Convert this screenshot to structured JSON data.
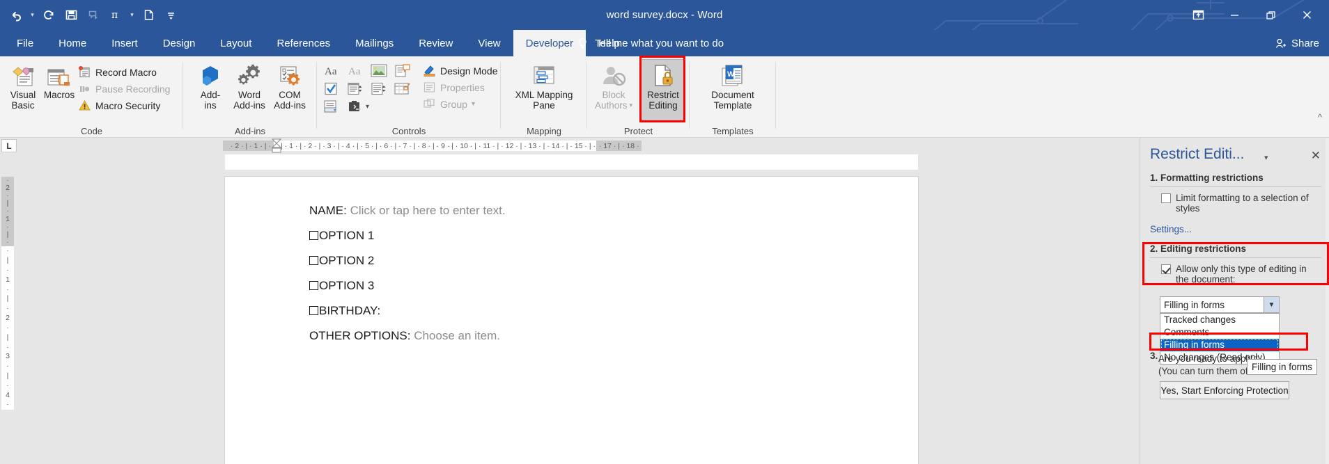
{
  "titlebar": {
    "document_title": "word survey.docx  -  Word",
    "quick_access": [
      {
        "name": "undo-icon",
        "label": "Undo",
        "caret": true
      },
      {
        "name": "redo-icon",
        "label": "Redo",
        "caret": false
      },
      {
        "name": "save-icon",
        "label": "Save",
        "caret": false
      },
      {
        "name": "touch-mode-icon",
        "label": "Touch/Mouse Mode",
        "caret": false,
        "dim": true
      },
      {
        "name": "equation-icon",
        "label": "Equation",
        "caret": true
      },
      {
        "name": "new-document-icon",
        "label": "New",
        "caret": false
      },
      {
        "name": "customize-qat-icon",
        "label": "Customize Quick Access Toolbar",
        "caret": false
      }
    ],
    "window_controls": [
      {
        "name": "ribbon-display-options-button",
        "label": "Ribbon Display Options"
      },
      {
        "name": "minimize-button",
        "label": "Minimize"
      },
      {
        "name": "restore-button",
        "label": "Restore Down"
      },
      {
        "name": "close-button",
        "label": "Close"
      }
    ]
  },
  "tabs": [
    {
      "label": "File",
      "active": false
    },
    {
      "label": "Home",
      "active": false
    },
    {
      "label": "Insert",
      "active": false
    },
    {
      "label": "Design",
      "active": false
    },
    {
      "label": "Layout",
      "active": false
    },
    {
      "label": "References",
      "active": false
    },
    {
      "label": "Mailings",
      "active": false
    },
    {
      "label": "Review",
      "active": false
    },
    {
      "label": "View",
      "active": false
    },
    {
      "label": "Developer",
      "active": true
    },
    {
      "label": "Help",
      "active": false
    }
  ],
  "tell_me": "Tell me what you want to do",
  "share": "Share",
  "ribbon": {
    "groups": [
      {
        "label": "Code"
      },
      {
        "label": "Add-ins"
      },
      {
        "label": "Controls"
      },
      {
        "label": "Mapping"
      },
      {
        "label": "Protect"
      },
      {
        "label": "Templates"
      }
    ],
    "code": {
      "visual_basic": "Visual\nBasic",
      "visual_basic_line1": "Visual",
      "visual_basic_line2": "Basic",
      "macros": "Macros",
      "record_macro": "Record Macro",
      "pause_recording": "Pause Recording",
      "macro_security": "Macro Security"
    },
    "addins": {
      "add_ins_line1": "Add-",
      "add_ins_line2": "ins",
      "word_add_ins_line1": "Word",
      "word_add_ins_line2": "Add-ins",
      "com_add_ins_line1": "COM",
      "com_add_ins_line2": "Add-ins"
    },
    "controls": {
      "design_mode": "Design Mode",
      "properties": "Properties",
      "group": "Group",
      "icons": [
        "rich-text-content-control-icon",
        "plain-text-content-control-icon",
        "picture-content-control-icon",
        "building-block-gallery-icon",
        "checkbox-content-control-icon",
        "combo-box-content-control-icon",
        "drop-down-list-content-control-icon",
        "date-picker-content-control-icon",
        "repeating-section-content-control-icon",
        "legacy-tools-icon"
      ]
    },
    "mapping": {
      "xml_mapping_pane_line1": "XML Mapping",
      "xml_mapping_pane_line2": "Pane"
    },
    "protect": {
      "block_authors_line1": "Block",
      "block_authors_line2": "Authors",
      "restrict_editing_line1": "Restrict",
      "restrict_editing_line2": "Editing"
    },
    "templates": {
      "document_template_line1": "Document",
      "document_template_line2": "Template"
    }
  },
  "ruler": {
    "horizontal_left": [
      "2",
      "1"
    ],
    "horizontal_right": [
      "1",
      "2",
      "3",
      "4",
      "5",
      "6",
      "7",
      "8",
      "9",
      "10",
      "11",
      "12",
      "13",
      "14",
      "15",
      "16",
      "17",
      "18"
    ],
    "vertical_top": [
      "2",
      "1"
    ],
    "vertical_bottom": [
      "1",
      "2",
      "3",
      "4"
    ],
    "corner_label": "L"
  },
  "document": {
    "lines": [
      {
        "label": "NAME:",
        "placeholder": "Click or tap here to enter text.",
        "checkbox": false
      },
      {
        "label": "OPTION 1",
        "placeholder": "",
        "checkbox": true
      },
      {
        "label": "OPTION 2",
        "placeholder": "",
        "checkbox": true
      },
      {
        "label": "OPTION 3",
        "placeholder": "",
        "checkbox": true
      },
      {
        "label": "BIRTHDAY:",
        "placeholder": "",
        "checkbox": true
      },
      {
        "label": "OTHER OPTIONS:",
        "placeholder": "Choose an item.",
        "checkbox": false
      }
    ]
  },
  "pane": {
    "title": "Restrict Editi...",
    "section1_heading": "1. Formatting restrictions",
    "limit_formatting_label": "Limit formatting to a selection of styles",
    "limit_formatting_checked": false,
    "settings_link": "Settings...",
    "section2_heading": "2. Editing restrictions",
    "allow_only_label": "Allow only this type of editing in the document:",
    "allow_only_checked": true,
    "combo_value": "Filling in forms",
    "dropdown_options": [
      {
        "label": "Tracked changes",
        "selected": false
      },
      {
        "label": "Comments",
        "selected": false
      },
      {
        "label": "Filling in forms",
        "selected": true
      },
      {
        "label": "No changes (Read only)",
        "selected": false
      }
    ],
    "section3_heading": "3.",
    "ready_text_line1": "Are you ready to apply t",
    "ready_text_line2": "(You can turn them off la",
    "enforce_button": "Yes, Start Enforcing Protection",
    "tooltip": "Filling in forms"
  },
  "colors": {
    "brand_blue": "#2b579a",
    "highlight_red": "#ff0000",
    "selection_blue": "#0a64c8",
    "ribbon_bg": "#f3f3f3",
    "pane_bg": "#e6e6e6"
  }
}
